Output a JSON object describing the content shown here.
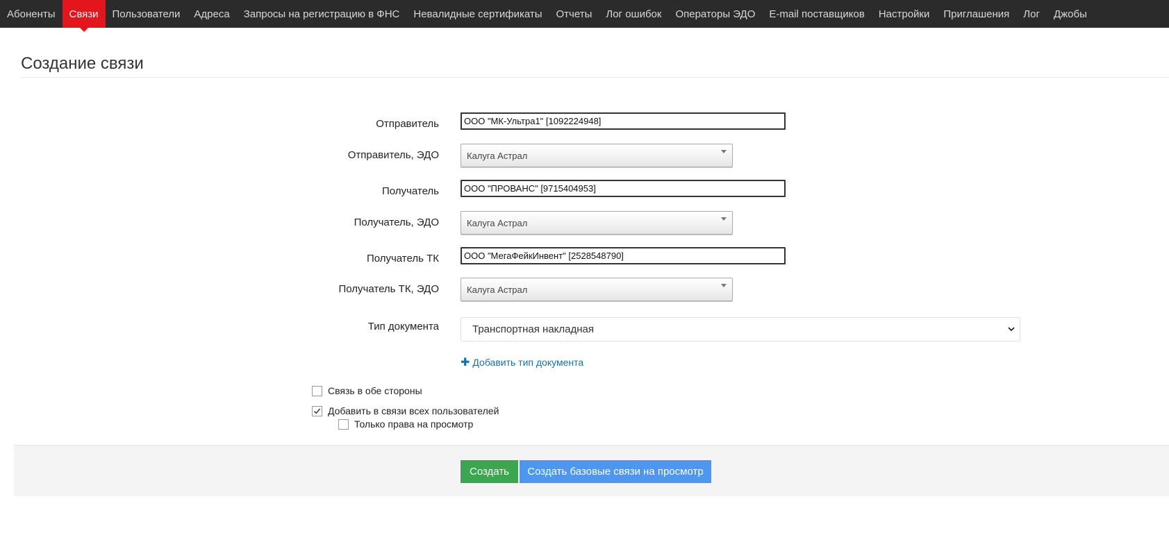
{
  "nav": {
    "items": [
      {
        "label": "Абоненты",
        "active": false
      },
      {
        "label": "Связи",
        "active": true
      },
      {
        "label": "Пользователи",
        "active": false
      },
      {
        "label": "Адреса",
        "active": false
      },
      {
        "label": "Запросы на регистрацию в ФНС",
        "active": false
      },
      {
        "label": "Невалидные сертификаты",
        "active": false
      },
      {
        "label": "Отчеты",
        "active": false
      },
      {
        "label": "Лог ошибок",
        "active": false
      },
      {
        "label": "Операторы ЭДО",
        "active": false
      },
      {
        "label": "E-mail поставщиков",
        "active": false
      },
      {
        "label": "Настройки",
        "active": false
      },
      {
        "label": "Приглашения",
        "active": false
      },
      {
        "label": "Лог",
        "active": false
      },
      {
        "label": "Джобы",
        "active": false
      }
    ],
    "colors": {
      "bar": "#2b2b2b",
      "active": "#e3161d"
    }
  },
  "page": {
    "title": "Создание связи"
  },
  "form": {
    "sender_label": "Отправитель",
    "sender_value": "ООО \"МК-Ультра1\" [1092224948]",
    "sender_edo_label": "Отправитель, ЭДО",
    "sender_edo_value": "Калуга Астрал",
    "recipient_label": "Получатель",
    "recipient_value": "ООО \"ПРОВАНС\" [9715404953]",
    "recipient_edo_label": "Получатель, ЭДО",
    "recipient_edo_value": "Калуга Астрал",
    "recipient_tk_label": "Получатель ТК",
    "recipient_tk_value": "ООО \"МегаФейкИнвент\" [2528548790]",
    "recipient_tk_edo_label": "Получатель ТК, ЭДО",
    "recipient_tk_edo_value": "Калуга Астрал",
    "doc_type_label": "Тип документа",
    "doc_type_value": "Транспортная накладная",
    "add_doc_type": "Добавить тип документа",
    "bidirectional_label": "Связь в обе стороны",
    "bidirectional_checked": false,
    "add_all_users_label": "Добавить в связи всех пользователей",
    "add_all_users_checked": true,
    "view_only_label": "Только права на просмотр",
    "view_only_checked": false
  },
  "actions": {
    "create": "Создать",
    "create_view": "Создать базовые связи на просмотр",
    "colors": {
      "create": "#3aa650",
      "create_view": "#4d97f0"
    }
  }
}
